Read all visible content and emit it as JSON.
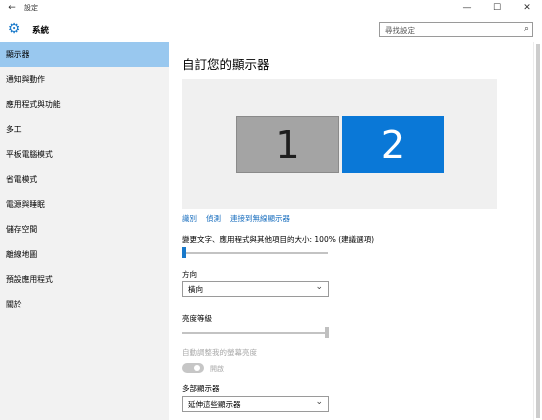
{
  "window": {
    "title": "設定",
    "back_glyph": "←",
    "minimize_glyph": "—",
    "maximize_glyph": "☐",
    "close_glyph": "✕"
  },
  "header": {
    "app_icon": "gear-icon",
    "app_name": "系統",
    "search_placeholder": "尋找設定",
    "search_icon": "search-icon"
  },
  "sidebar": {
    "items": [
      {
        "label": "顯示器",
        "active": true
      },
      {
        "label": "通知與動作",
        "active": false
      },
      {
        "label": "應用程式與功能",
        "active": false
      },
      {
        "label": "多工",
        "active": false
      },
      {
        "label": "平板電腦模式",
        "active": false
      },
      {
        "label": "省電模式",
        "active": false
      },
      {
        "label": "電源與睡眠",
        "active": false
      },
      {
        "label": "儲存空間",
        "active": false
      },
      {
        "label": "離線地圖",
        "active": false
      },
      {
        "label": "預設應用程式",
        "active": false
      },
      {
        "label": "關於",
        "active": false
      }
    ]
  },
  "main": {
    "title": "自訂您的顯示器",
    "monitors": [
      {
        "number": "1",
        "selected": false
      },
      {
        "number": "2",
        "selected": true
      }
    ],
    "links": [
      "識別",
      "偵測",
      "連接到無線顯示器"
    ],
    "scale": {
      "label": "變更文字、應用程式與其他項目的大小: 100% (建議選項)",
      "value_percent": 0
    },
    "orientation": {
      "label": "方向",
      "value": "橫向"
    },
    "brightness": {
      "label": "亮度等級",
      "value_percent": 100
    },
    "auto_brightness": {
      "label": "自動調整我的螢幕亮度",
      "state_text": "開啟",
      "on": true,
      "enabled": false
    },
    "multiple_displays": {
      "label": "多部顯示器",
      "value": "延伸這些顯示器"
    }
  },
  "colors": {
    "accent": "#0a78d7",
    "sidebar_active": "#99c8ef",
    "link": "#1a6fbf"
  }
}
